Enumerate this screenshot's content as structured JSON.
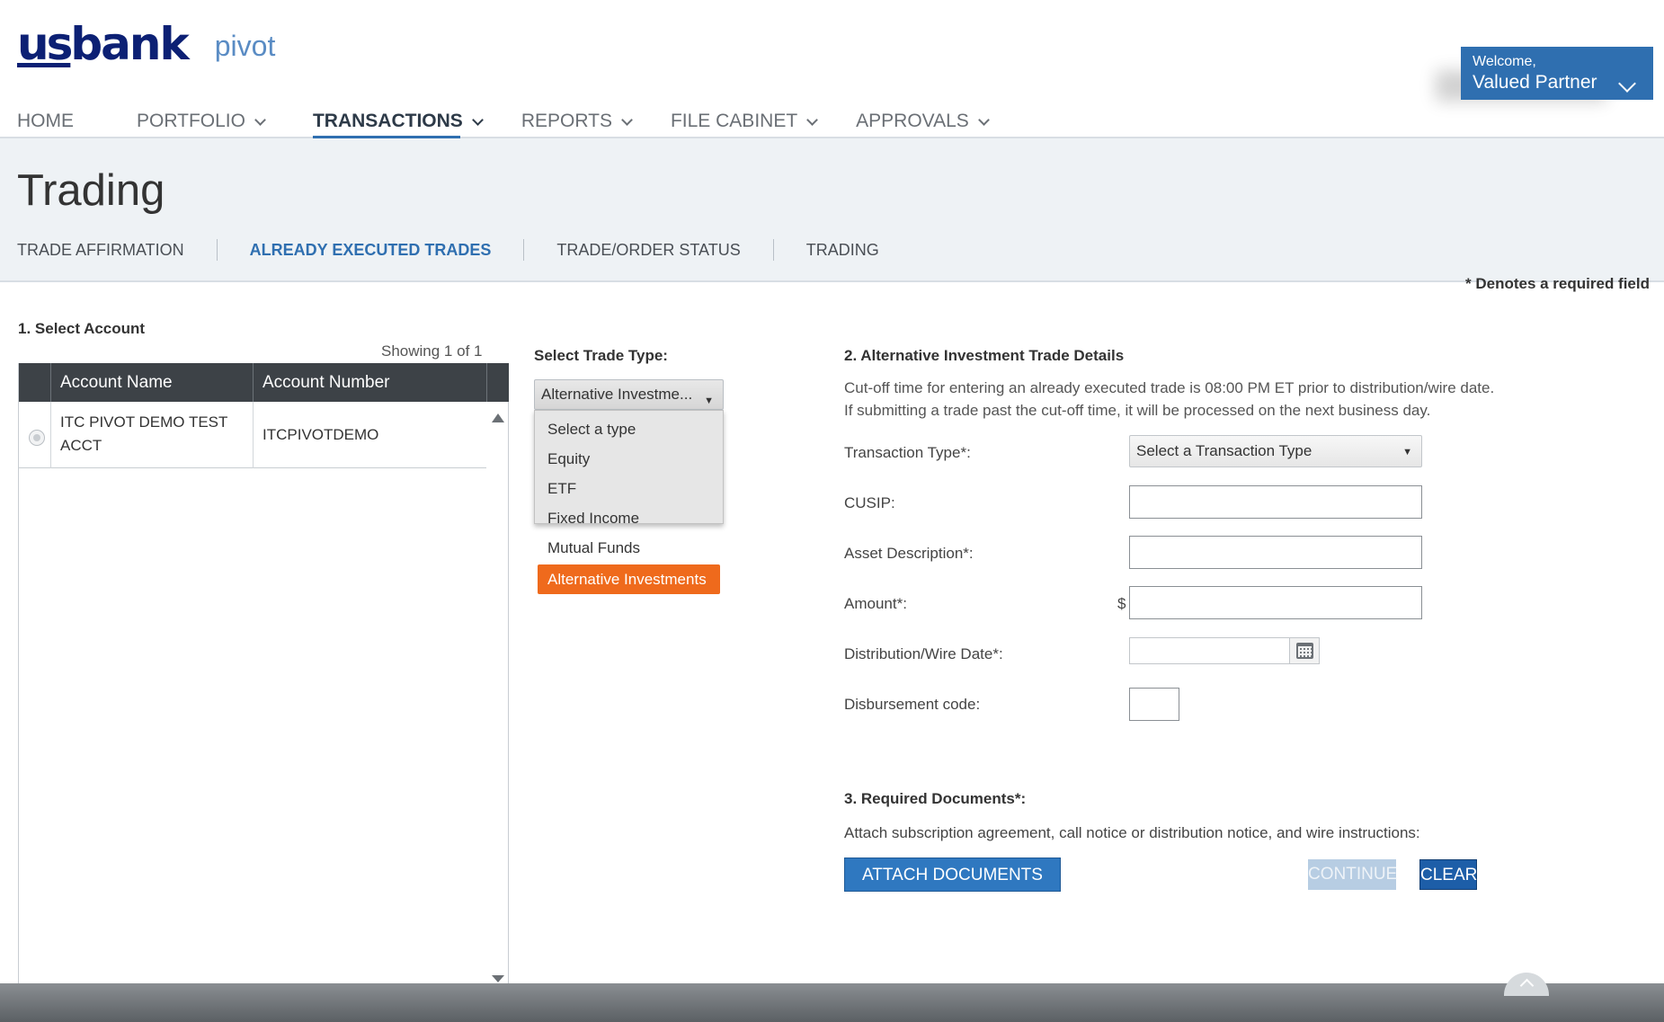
{
  "brand": {
    "logo_text": "usbank",
    "product": "pivot"
  },
  "welcome": {
    "greeting": "Welcome,",
    "user": "Valued Partner"
  },
  "nav": {
    "home": "HOME",
    "portfolio": "PORTFOLIO",
    "transactions": "TRANSACTIONS",
    "reports": "REPORTS",
    "file_cabinet": "FILE CABINET",
    "approvals": "APPROVALS"
  },
  "page": {
    "title": "Trading"
  },
  "subnav": {
    "trade_affirmation": "TRADE AFFIRMATION",
    "already_executed": "ALREADY EXECUTED TRADES",
    "trade_order_status": "TRADE/ORDER STATUS",
    "trading": "TRADING"
  },
  "account_section": {
    "heading": "1. Select Account",
    "showing": "Showing 1 of 1",
    "columns": [
      "Account Name",
      "Account Number"
    ],
    "rows": [
      {
        "name_line1": "ITC PIVOT DEMO TEST",
        "name_line2": "ACCT",
        "number": "ITCPIVOTDEMO"
      }
    ]
  },
  "trade_type": {
    "label": "Select Trade Type:",
    "selected_display": "Alternative Investme...",
    "options": [
      "Select a type",
      "Equity",
      "ETF",
      "Fixed Income",
      "Mutual Funds",
      "Alternative Investments"
    ],
    "selected_index": 5
  },
  "details": {
    "required_note": "* Denotes a required field",
    "heading": "2. Alternative Investment Trade Details",
    "cutoff_line1": "Cut-off time for entering an already executed trade is 08:00 PM ET prior to distribution/wire date.",
    "cutoff_line2": "If submitting a trade past the cut-off time, it will be processed on the next business day.",
    "transaction_type_label": "Transaction Type*:",
    "transaction_type_value": "Select a Transaction Type",
    "cusip_label": "CUSIP:",
    "cusip_value": "",
    "asset_label": "Asset Description*:",
    "asset_value": "",
    "amount_label": "Amount*:",
    "amount_prefix": "$",
    "amount_value": "",
    "date_label": "Distribution/Wire Date*:",
    "date_value": "",
    "disbursement_label": "Disbursement code:",
    "disbursement_value": ""
  },
  "documents": {
    "heading": "3. Required Documents*:",
    "instructions": "Attach subscription agreement, call notice or distribution notice, and wire instructions:",
    "attach_label": "ATTACH DOCUMENTS",
    "continue_label": "CONTINUE",
    "clear_label": "CLEAR"
  },
  "colors": {
    "brand_navy": "#0c2074",
    "accent_blue": "#2f6fb0",
    "selected_orange": "#ef6a1c"
  }
}
